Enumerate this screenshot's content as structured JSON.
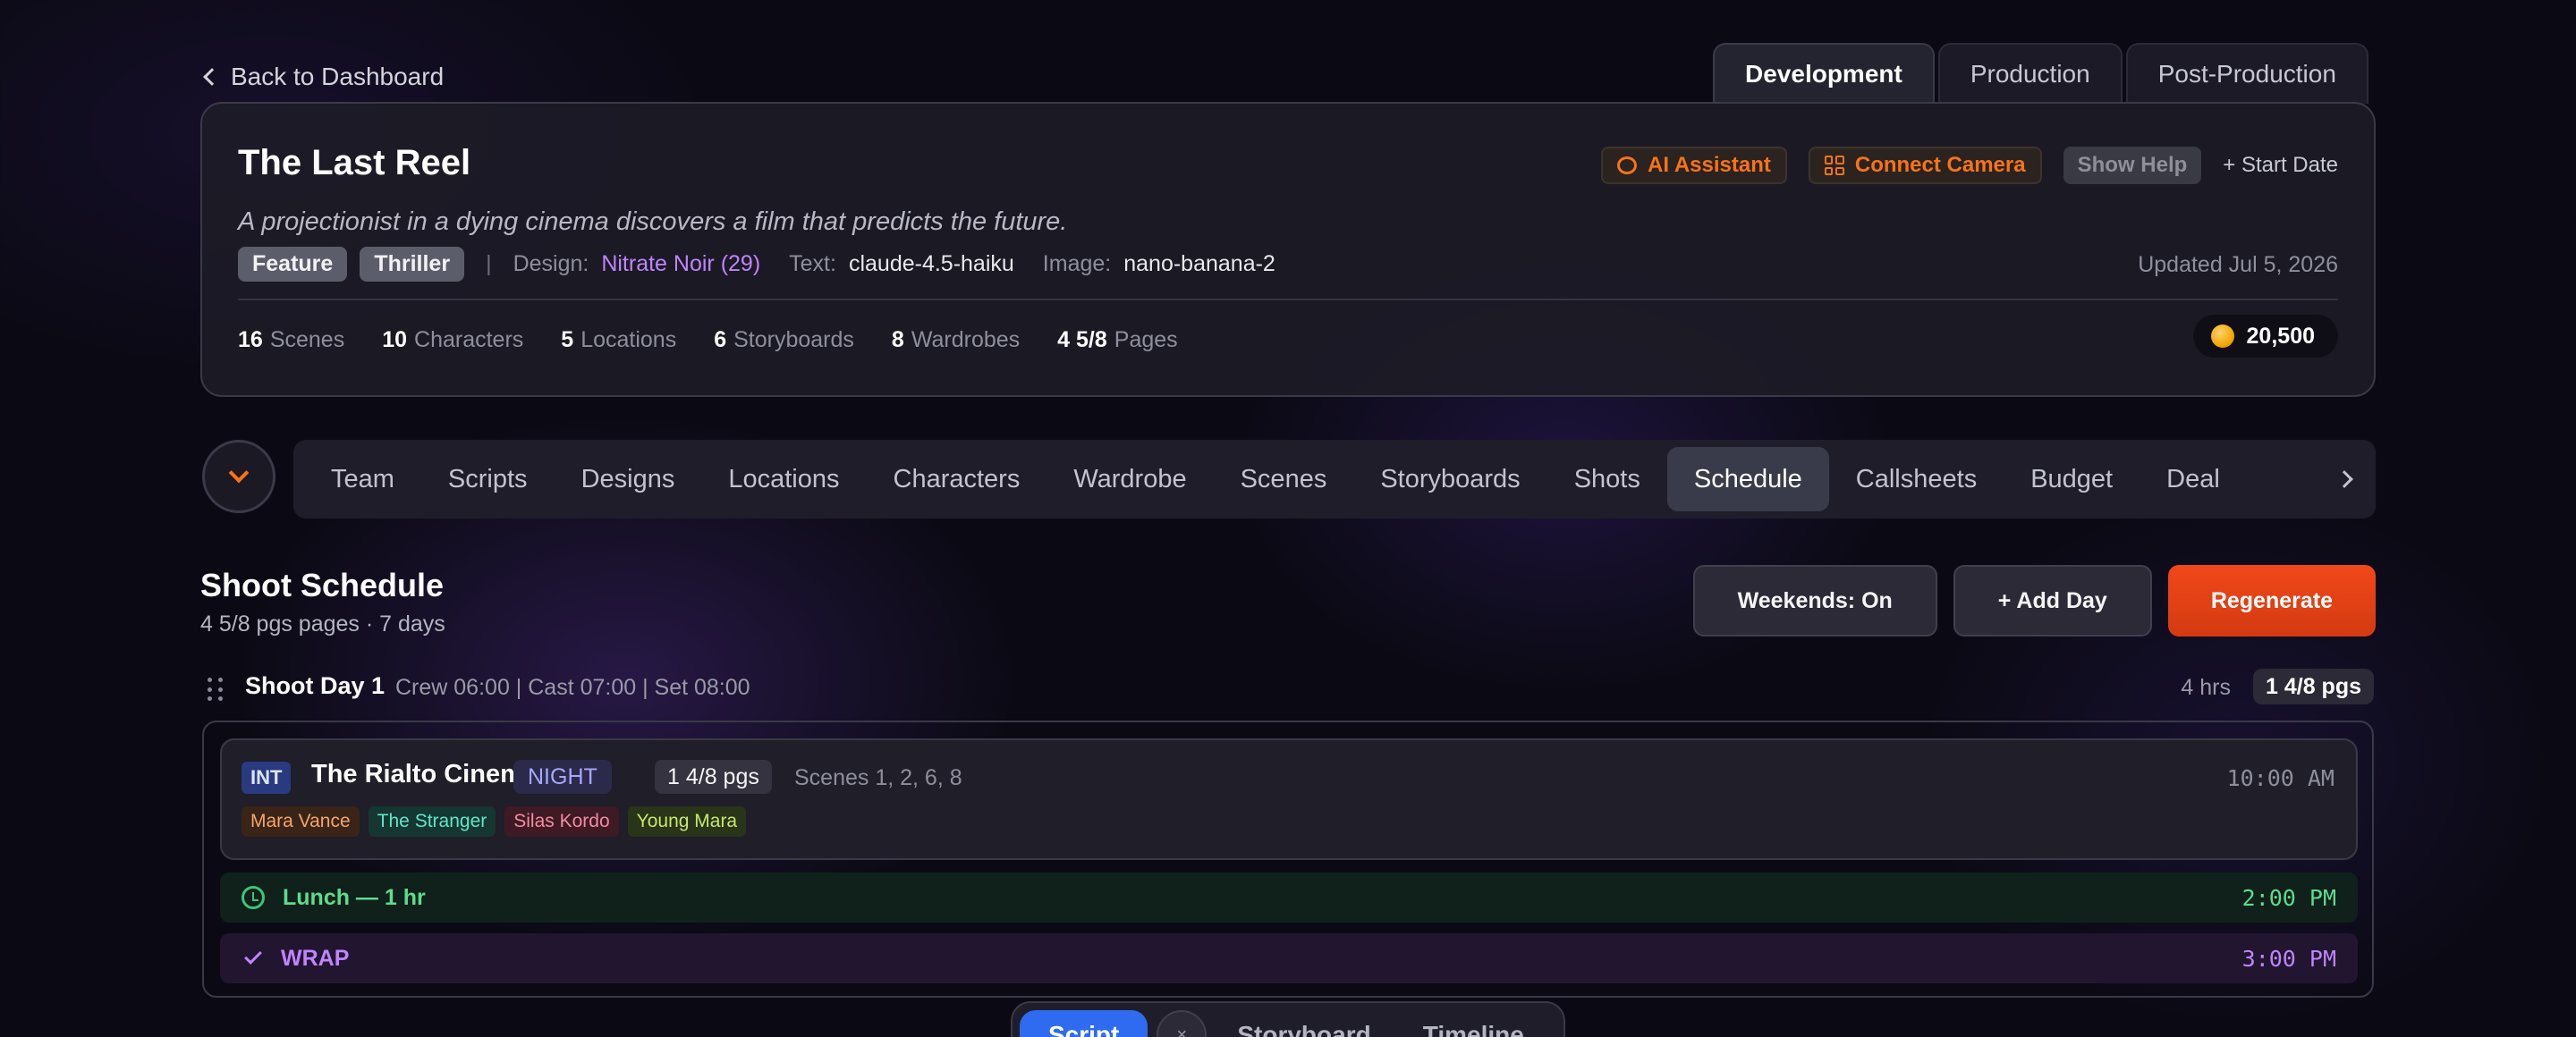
{
  "back": {
    "label": "Back to Dashboard"
  },
  "phase_tabs": [
    "Development",
    "Production",
    "Post-Production"
  ],
  "project": {
    "title": "The Last Reel",
    "logline": "A projectionist in a dying cinema discovers a film that predicts the future.",
    "tags": [
      "Feature",
      "Thriller"
    ],
    "design_label": "Design:",
    "design_value": "Nitrate Noir (29)",
    "text_label": "Text:",
    "text_value": "claude-4.5-haiku",
    "image_label": "Image:",
    "image_value": "nano-banana-2",
    "updated": "Updated Jul 5, 2026",
    "credits": "20,500"
  },
  "actions": {
    "ai_assistant": "AI Assistant",
    "connect_camera": "Connect Camera",
    "show_help": "Show Help",
    "start_date": "+ Start Date"
  },
  "stats": [
    {
      "num": "16",
      "label": "Scenes"
    },
    {
      "num": "10",
      "label": "Characters"
    },
    {
      "num": "5",
      "label": "Locations"
    },
    {
      "num": "6",
      "label": "Storyboards"
    },
    {
      "num": "8",
      "label": "Wardrobes"
    },
    {
      "num": "4 5/8",
      "label": "Pages"
    }
  ],
  "nav": [
    "Team",
    "Scripts",
    "Designs",
    "Locations",
    "Characters",
    "Wardrobe",
    "Scenes",
    "Storyboards",
    "Shots",
    "Schedule",
    "Callsheets",
    "Budget",
    "Deal"
  ],
  "schedule": {
    "title": "Shoot Schedule",
    "subtitle": "4 5/8 pgs pages · 7 days",
    "weekends": "Weekends: On",
    "add_day": "+ Add Day",
    "regenerate": "Regenerate"
  },
  "day1": {
    "title": "Shoot Day 1",
    "calls": "Crew 06:00 | Cast 07:00 | Set 08:00",
    "hours": "4 hrs",
    "pages": "1 4/8 pgs",
    "scene": {
      "int_ext": "INT",
      "location": "The Rialto Cinema",
      "time_of_day": "NIGHT",
      "pages": "1 4/8 pgs",
      "scenes": "Scenes 1, 2, 6, 8",
      "time": "10:00 AM",
      "cast": [
        "Mara Vance",
        "The Stranger",
        "Silas Kordo",
        "Young Mara"
      ]
    },
    "lunch": {
      "label": "Lunch — 1 hr",
      "time": "2:00 PM"
    },
    "wrap": {
      "label": "WRAP",
      "time": "3:00 PM"
    }
  },
  "dock": {
    "active": "Script",
    "close": "×",
    "items": [
      "Storyboard",
      "Timeline"
    ]
  },
  "colors": {
    "accent_orange": "#f97316",
    "accent_purple": "#c084fc",
    "regen_red": "#e2431a",
    "dock_blue": "#2f6bf0"
  }
}
